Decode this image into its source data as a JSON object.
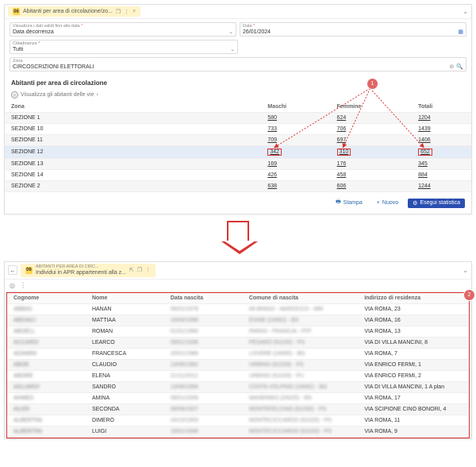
{
  "panel1": {
    "tab_title": "Abitanti per area di circolazione/zo...",
    "filters": {
      "date_filter_label": "Visualizza i dati validi fino alla data",
      "date_filter_value": "Data decorrenza",
      "data_label": "Data",
      "data_value": "26/01/2024",
      "citt_label": "Cittadinanza",
      "citt_value": "Tutti",
      "zona_label": "Zona",
      "zona_value": "CIRCOSCRIZIONI ELETTORALI"
    },
    "section_title": "Abitanti per area di circolazione",
    "drill_text": "Visualizza gli abitanti delle vie",
    "cols": {
      "zona": "Zona",
      "m": "Maschi",
      "f": "Femmine",
      "t": "Totali"
    },
    "rows": [
      {
        "z": "SEZIONE 1",
        "m": "580",
        "f": "624",
        "t": "1204"
      },
      {
        "z": "SEZIONE 10",
        "m": "733",
        "f": "706",
        "t": "1439"
      },
      {
        "z": "SEZIONE 11",
        "m": "709",
        "f": "697",
        "t": "1406"
      },
      {
        "z": "SEZIONE 12",
        "m": "342",
        "f": "310",
        "t": "652",
        "sel": true,
        "box": true
      },
      {
        "z": "SEZIONE 13",
        "m": "169",
        "f": "176",
        "t": "345"
      },
      {
        "z": "SEZIONE 14",
        "m": "426",
        "f": "458",
        "t": "884"
      },
      {
        "z": "SEZIONE 2",
        "m": "638",
        "f": "606",
        "t": "1244"
      }
    ],
    "buttons": {
      "stampa": "Stampa",
      "nuovo": "Nuovo",
      "esegui": "Esegui statistica"
    },
    "badge1": "1"
  },
  "panel2": {
    "breadcrumb": "ABITANTI PER AREA DI CIRC...",
    "tab_title": "Individui in APR appartenenti alla z...",
    "cols": {
      "cognome": "Cognome",
      "nome": "Nome",
      "dn": "Data nascita",
      "cn": "Comune di nascita",
      "ind": "Indirizzo di residenza"
    },
    "rows": [
      {
        "c": "ABBAS",
        "n": "HANAN",
        "d": "06/01/1978",
        "m": "MI-BINGO - MAROCCO - MM",
        "i": "VIA ROMA, 23"
      },
      {
        "c": "ABDIACI",
        "n": "MATTIAA",
        "d": "16/04/1996",
        "m": "ESINE (23082) - BS",
        "i": "VIA ROMA, 16"
      },
      {
        "c": "ABOELL",
        "n": "ROMAN",
        "d": "01/01/1960",
        "m": "PARIGI - FRANCIA - FFF",
        "i": "VIA ROMA, 13"
      },
      {
        "c": "ACCARDI",
        "n": "LEARCO",
        "d": "09/01/1936",
        "m": "PESARO (61100) - PS",
        "i": "VIA DI VILLA MANCINI, 8"
      },
      {
        "c": "ADAMINI",
        "n": "FRANCESCA",
        "d": "20/01/1986",
        "m": "LOVERE (24065) - BG",
        "i": "VIA ROMA, 7"
      },
      {
        "c": "ABOE",
        "n": "CLAUDIO",
        "d": "13/06/1962",
        "m": "URBINO (61029) - PS",
        "i": "VIA ENRICO FERMI, 1"
      },
      {
        "c": "ABORE",
        "n": "ELENA",
        "d": "21/11/2012",
        "m": "URBINO (61029) - PU",
        "i": "VIA ENRICO FERMI, 2"
      },
      {
        "c": "AGLIARDI",
        "n": "SANDRO",
        "d": "13/06/1994",
        "m": "COSTA VOLPINO (24062) - BG",
        "i": "VIA DI VILLA MANCINI, 1 A plan"
      },
      {
        "c": "AHMED",
        "n": "AMINA",
        "d": "08/01/2009",
        "m": "MANERBIO (25025) - BS",
        "i": "VIA ROMA, 17"
      },
      {
        "c": "AILER",
        "n": "SECONDA",
        "d": "08/06/1927",
        "m": "MONTEFELCINO (61030) - PS",
        "i": "VIA SCIPIONE CINO BONORI, 4"
      },
      {
        "c": "ALBERTINI",
        "n": "DIMERO",
        "d": "24/10/1953",
        "m": "MONTECICCARDO (61020) - PS",
        "i": "VIA ROMA, 11"
      },
      {
        "c": "ALBERTINI",
        "n": "LUIGI",
        "d": "19/01/1946",
        "m": "MONTECICCARDO (61020) - PS",
        "i": "VIA ROMA, 9"
      }
    ],
    "badge2": "2"
  }
}
